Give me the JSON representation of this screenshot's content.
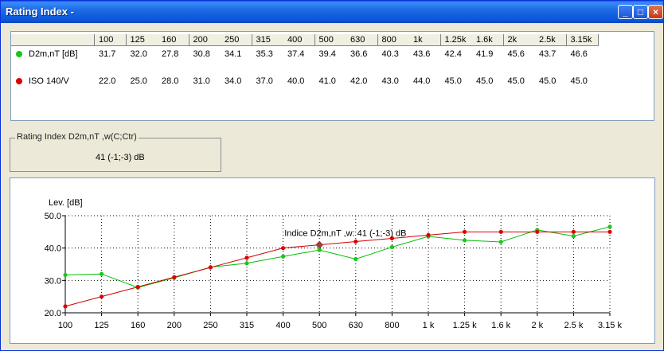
{
  "window": {
    "title": "Rating Index -"
  },
  "controls": {
    "minimize": "_",
    "maximize": "□",
    "close": "×"
  },
  "table": {
    "headers": [
      "100",
      "125",
      "160",
      "200",
      "250",
      "315",
      "400",
      "500",
      "630",
      "800",
      "1k",
      "1.25k",
      "1.6k",
      "2k",
      "2.5k",
      "3.15k"
    ],
    "rows": [
      {
        "label": "D2m,nT [dB]",
        "color": "#18c818",
        "values": [
          "31.7",
          "32.0",
          "27.8",
          "30.8",
          "34.1",
          "35.3",
          "37.4",
          "39.4",
          "36.6",
          "40.3",
          "43.6",
          "42.4",
          "41.9",
          "45.6",
          "43.7",
          "46.6"
        ]
      },
      {
        "label": "ISO 140/V",
        "color": "#e00000",
        "values": [
          "22.0",
          "25.0",
          "28.0",
          "31.0",
          "34.0",
          "37.0",
          "40.0",
          "41.0",
          "42.0",
          "43.0",
          "44.0",
          "45.0",
          "45.0",
          "45.0",
          "45.0",
          "45.0"
        ]
      }
    ]
  },
  "rating": {
    "legend": "Rating Index D2m,nT ,w(C;Ctr)",
    "value": "41 (-1;-3) dB"
  },
  "chart_data": {
    "type": "line",
    "ylabel": "Lev. [dB]",
    "ylim": [
      20.0,
      50.0
    ],
    "yticks": [
      "20.0",
      "30.0",
      "40.0",
      "50.0"
    ],
    "categories": [
      "100",
      "125",
      "160",
      "200",
      "250",
      "315",
      "400",
      "500",
      "630",
      "800",
      "1 k",
      "1.25 k",
      "1.6 k",
      "2 k",
      "2.5 k",
      "3.15 k"
    ],
    "series": [
      {
        "name": "D2m,nT [dB]",
        "color": "#18c818",
        "line_color": "#00c000",
        "values": [
          31.7,
          32.0,
          27.8,
          30.8,
          34.1,
          35.3,
          37.4,
          39.4,
          36.6,
          40.3,
          43.6,
          42.4,
          41.9,
          45.6,
          43.7,
          46.6
        ]
      },
      {
        "name": "ISO 140/V",
        "color": "#e00000",
        "line_color": "#d00000",
        "values": [
          22.0,
          25.0,
          28.0,
          31.0,
          34.0,
          37.0,
          40.0,
          41.0,
          42.0,
          43.0,
          44.0,
          45.0,
          45.0,
          45.0,
          45.0,
          45.0
        ]
      }
    ],
    "annotation": {
      "text": "Indice  D2m,nT ,w: 41 (-1;-3) dB",
      "category": "500",
      "value": 41.0,
      "color": "#a04040"
    },
    "grid": "dotted"
  }
}
